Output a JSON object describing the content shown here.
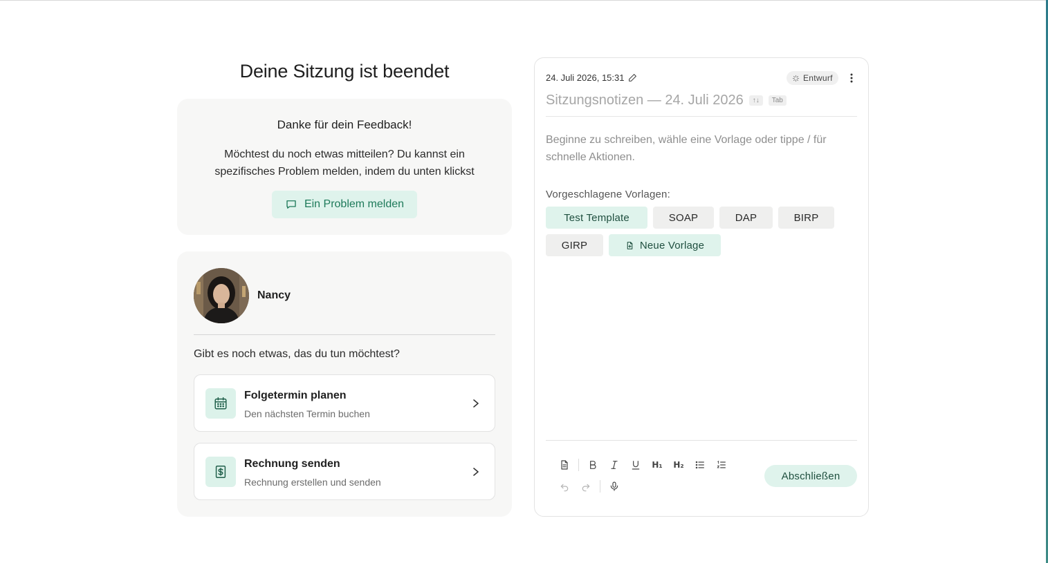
{
  "page": {
    "title": "Deine Sitzung ist beendet"
  },
  "feedback": {
    "title": "Danke für dein Feedback!",
    "text": "Möchtest du noch etwas mitteilen? Du kannst ein spezifisches Problem melden, indem du unten klickst",
    "report_button": "Ein Problem melden"
  },
  "client": {
    "name": "Nancy",
    "question": "Gibt es noch etwas, das du tun möchtest?",
    "actions": [
      {
        "title": "Folgetermin planen",
        "subtitle": "Den nächsten Termin buchen",
        "icon": "calendar-icon"
      },
      {
        "title": "Rechnung senden",
        "subtitle": "Rechnung erstellen und senden",
        "icon": "invoice-icon"
      }
    ]
  },
  "editor": {
    "date": "24. Juli 2026, 15:31",
    "status": "Entwurf",
    "note_title": "Sitzungsnotizen — 24. Juli 2026",
    "shortcut_arrows": "↑↓",
    "shortcut_tab": "Tab",
    "placeholder": "Beginne zu schreiben, wähle eine Vorlage oder tippe / für schnelle Aktionen.",
    "templates_label": "Vorgeschlagene Vorlagen:",
    "templates": [
      "Test Template",
      "SOAP",
      "DAP",
      "BIRP",
      "GIRP"
    ],
    "new_template": "Neue Vorlage",
    "toolbar": {
      "h1": "H₁",
      "h2": "H₂"
    },
    "finish_button": "Abschließen"
  },
  "colors": {
    "accent_bg": "#dff3ec",
    "accent_text": "#1e7a5a",
    "card_bg": "#f7f7f6"
  }
}
